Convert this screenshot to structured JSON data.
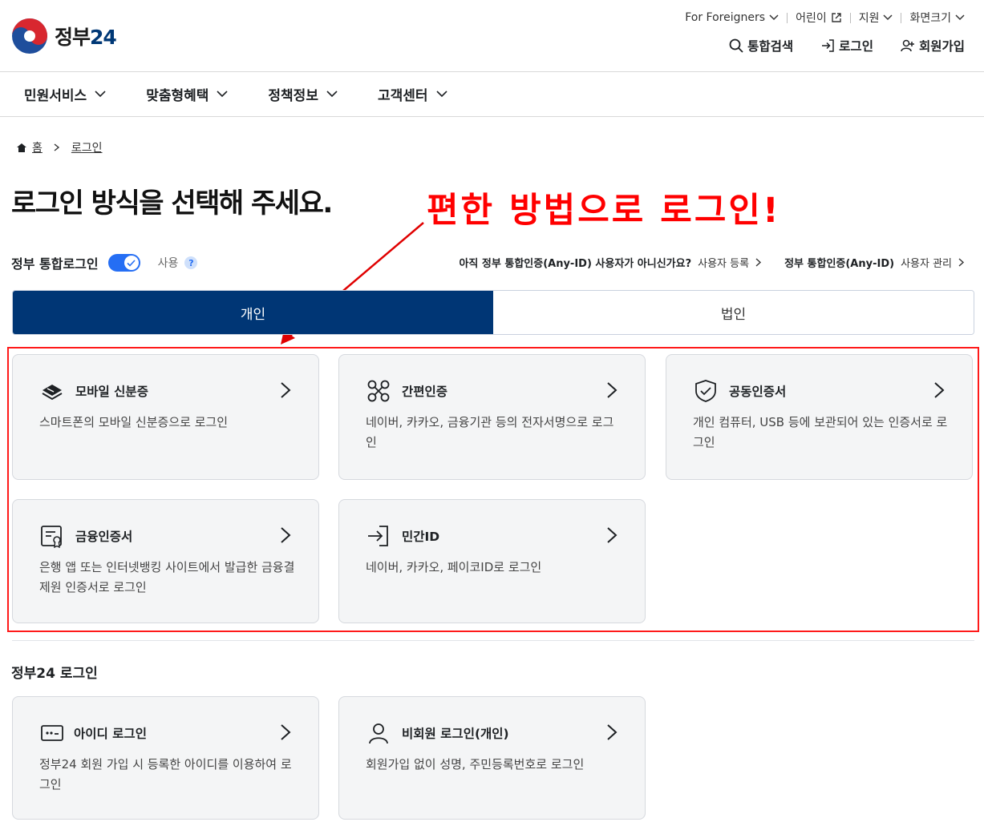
{
  "header": {
    "logo_text": "정부",
    "logo_num": "24",
    "utility": [
      {
        "label": "For Foreigners"
      },
      {
        "label": "어린이"
      },
      {
        "label": "지원"
      },
      {
        "label": "화면크기"
      }
    ],
    "links": {
      "search": "통합검색",
      "login": "로그인",
      "signup": "회원가입"
    }
  },
  "nav": {
    "items": [
      "민원서비스",
      "맞춤형혜택",
      "정책정보",
      "고객센터"
    ]
  },
  "breadcrumb": {
    "home": "홈",
    "current": "로그인"
  },
  "page_title": "로그인 방식을 선택해 주세요.",
  "annotation": "편한 방법으로 로그인!",
  "unified": {
    "label": "정부 통합로그인",
    "use": "사용",
    "help": "?",
    "anyid_question": "아직 정부 통합인증(Any-ID) 사용자가 아니신가요?",
    "anyid_register": "사용자 등록",
    "anyid_label": "정부 통합인증(Any-ID)",
    "anyid_manage": "사용자 관리"
  },
  "tabs": {
    "personal": "개인",
    "corporate": "법인"
  },
  "cards": [
    {
      "title": "모바일 신분증",
      "desc": "스마트폰의 모바일 신분증으로 로그인",
      "icon": "mobile-id-icon"
    },
    {
      "title": "간편인증",
      "desc": "네이버, 카카오, 금융기관 등의 전자서명으로 로그인",
      "icon": "simple-auth-icon"
    },
    {
      "title": "공동인증서",
      "desc": "개인 컴퓨터, USB 등에 보관되어 있는 인증서로 로그인",
      "icon": "shield-check-icon"
    },
    {
      "title": "금융인증서",
      "desc": "은행 앱 또는 인터넷뱅킹 사이트에서 발급한 금융결제원 인증서로 로그인",
      "icon": "certificate-icon"
    },
    {
      "title": "민간ID",
      "desc": "네이버, 카카오, 페이코ID로 로그인",
      "icon": "login-arrow-icon"
    }
  ],
  "gov24": {
    "section_title": "정부24 로그인",
    "cards": [
      {
        "title": "아이디 로그인",
        "desc": "정부24 회원 가입 시 등록한 아이디를 이용하여 로그인",
        "icon": "id-card-icon"
      },
      {
        "title": "비회원 로그인(개인)",
        "desc": "회원가입 없이 성명, 주민등록번호로 로그인",
        "icon": "person-icon"
      }
    ]
  },
  "colors": {
    "primary": "#003675",
    "accent": "#256ef4",
    "annotation": "#ff0000"
  }
}
